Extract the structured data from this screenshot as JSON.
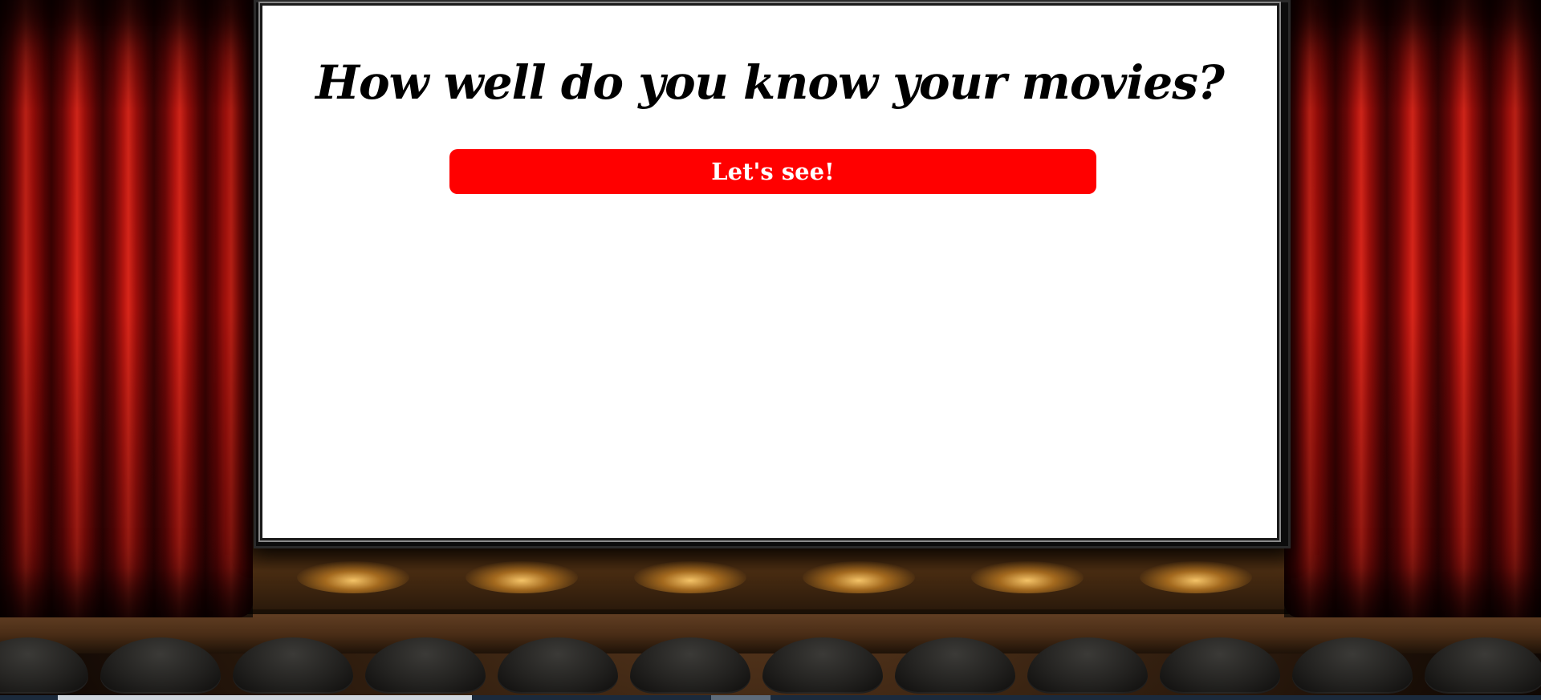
{
  "page": {
    "title": "How well do you know your movies?"
  },
  "quiz": {
    "heading": "How well do you know your movies?",
    "start_button_label": "Let's see!"
  },
  "colors": {
    "button_background": "#ff0000",
    "button_text": "#ffffff",
    "screen_background": "#ffffff",
    "heading_text": "#000000",
    "curtain": "#b81610"
  }
}
